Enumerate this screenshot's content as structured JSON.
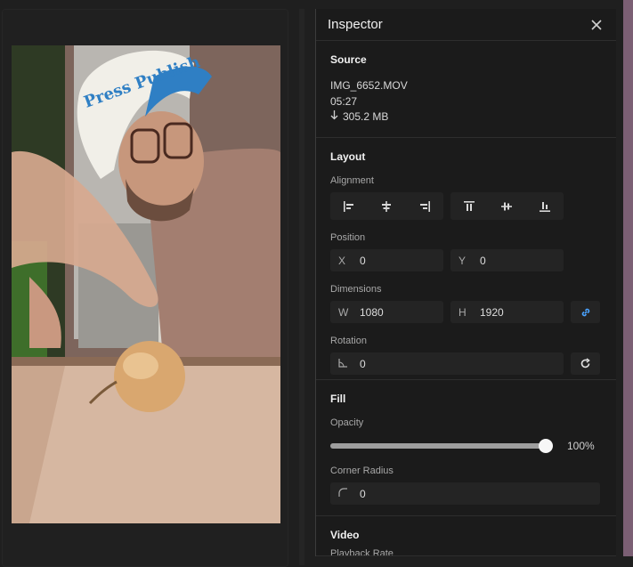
{
  "inspector": {
    "title": "Inspector",
    "source": {
      "heading": "Source",
      "file_name": "IMG_6652.MOV",
      "duration": "05:27",
      "size": "305.2 MB",
      "size_icon": "download-arrow-icon"
    },
    "layout": {
      "heading": "Layout",
      "alignment_label": "Alignment",
      "alignment_buttons": [
        "align-left",
        "align-center-horizontal",
        "align-right",
        "align-top",
        "align-center-vertical",
        "align-bottom"
      ],
      "position_label": "Position",
      "x_key": "X",
      "x_value": "0",
      "y_key": "Y",
      "y_value": "0",
      "dimensions_label": "Dimensions",
      "w_key": "W",
      "w_value": "1080",
      "h_key": "H",
      "h_value": "1920",
      "rotation_label": "Rotation",
      "rotation_value": "0"
    },
    "fill": {
      "heading": "Fill",
      "opacity_label": "Opacity",
      "opacity_value": "100%",
      "opacity_fraction": 1.0,
      "corner_radius_label": "Corner Radius",
      "corner_radius_value": "0"
    },
    "video": {
      "heading": "Video",
      "sub_label": "Playback Rate"
    }
  },
  "preview": {
    "cap_text": "Press Publish"
  },
  "colors": {
    "link_accent": "#4aa3ff",
    "panel_bg": "#1b1b1b",
    "field_bg": "#242424"
  }
}
